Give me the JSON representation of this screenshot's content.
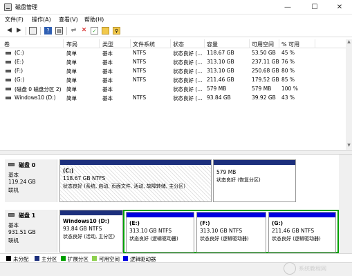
{
  "window": {
    "title": "磁盘管理",
    "min_glyph": "—",
    "max_glyph": "☐",
    "close_glyph": "✕"
  },
  "menu": [
    "文件(F)",
    "操作(A)",
    "查看(V)",
    "帮助(H)"
  ],
  "toolbar_icons": [
    "back-icon",
    "forward-icon",
    "console-tree-icon",
    "help-icon",
    "properties-icon",
    "connect-icon",
    "delete-icon",
    "checklist-icon",
    "folder-icon",
    "folder-search-icon"
  ],
  "volume_list": {
    "headers": [
      "卷",
      "布局",
      "类型",
      "文件系统",
      "状态",
      "容量",
      "可用空间",
      "% 可用"
    ],
    "rows": [
      [
        "(C:)",
        "简单",
        "基本",
        "NTFS",
        "状态良好 (...",
        "118.67 GB",
        "53.50 GB",
        "45 %"
      ],
      [
        "(E:)",
        "简单",
        "基本",
        "NTFS",
        "状态良好 (...",
        "313.10 GB",
        "237.11 GB",
        "76 %"
      ],
      [
        "(F:)",
        "简单",
        "基本",
        "NTFS",
        "状态良好 (...",
        "313.10 GB",
        "250.68 GB",
        "80 %"
      ],
      [
        "(G:)",
        "简单",
        "基本",
        "NTFS",
        "状态良好 (...",
        "211.46 GB",
        "179.52 GB",
        "85 %"
      ],
      [
        "(磁盘 0 磁盘分区 2)",
        "简单",
        "基本",
        "",
        "状态良好 (...",
        "579 MB",
        "579 MB",
        "100 %"
      ],
      [
        "Windows10 (D:)",
        "简单",
        "基本",
        "NTFS",
        "状态良好 (...",
        "93.84 GB",
        "39.92 GB",
        "43 %"
      ]
    ]
  },
  "disks": [
    {
      "name": "磁盘 0",
      "type": "基本",
      "size": "119.24 GB",
      "status": "联机",
      "partitions": [
        {
          "name": "(C:)",
          "size": "118.67 GB NTFS",
          "status": "状态良好 (系统, 启动, 页面文件, 活动, 故障转储, 主分区)"
        },
        {
          "name": "",
          "size": "579 MB",
          "status": "状态良好 (恢复分区)"
        }
      ]
    },
    {
      "name": "磁盘 1",
      "type": "基本",
      "size": "931.51 GB",
      "status": "联机",
      "partitions": [
        {
          "name": "Windows10  (D:)",
          "size": "93.84 GB NTFS",
          "status": "状态良好 (活动, 主分区)"
        },
        {
          "name": "(E:)",
          "size": "313.10 GB NTFS",
          "status": "状态良好 (逻辑驱动器)"
        },
        {
          "name": "(F:)",
          "size": "313.10 GB NTFS",
          "status": "状态良好 (逻辑驱动器)"
        },
        {
          "name": "(G:)",
          "size": "211.46 GB NTFS",
          "status": "状态良好 (逻辑驱动器)"
        }
      ]
    }
  ],
  "legend": [
    {
      "label": "未分配",
      "color": "#000000"
    },
    {
      "label": "主分区",
      "color": "#1c2f7c"
    },
    {
      "label": "扩展分区",
      "color": "#00a000"
    },
    {
      "label": "可用空间",
      "color": "#8fd14f"
    },
    {
      "label": "逻辑驱动器",
      "color": "#0000e0"
    }
  ],
  "watermark": "系统教程网",
  "colors": {
    "primary": "#1c2f7c",
    "logical": "#0000e0",
    "extended": "#00a000"
  }
}
